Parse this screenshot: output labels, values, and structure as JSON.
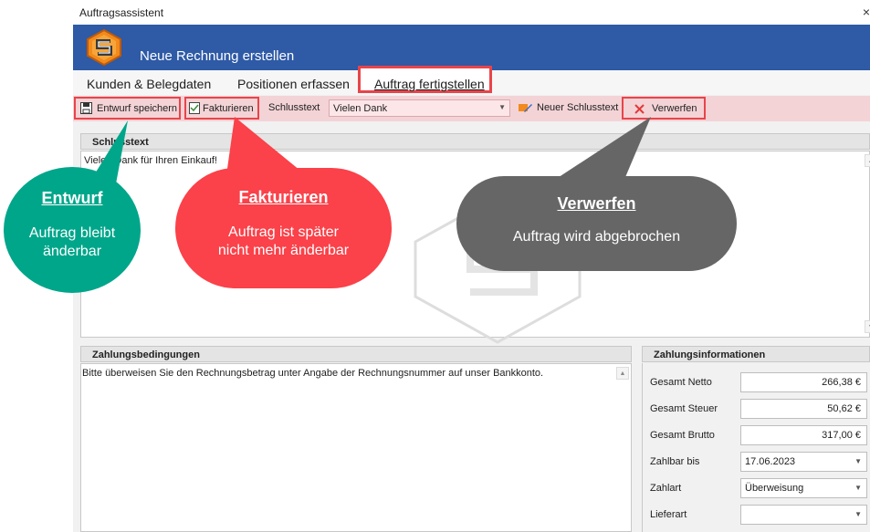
{
  "window": {
    "title": "Auftragsassistent",
    "close_glyph": "×"
  },
  "header": {
    "title": "Neue Rechnung erstellen",
    "color": "#2e5aa6"
  },
  "tabs": [
    {
      "label": "Kunden & Belegdaten"
    },
    {
      "label": "Positionen erfassen"
    },
    {
      "label": "Auftrag fertigstellen",
      "active": true
    }
  ],
  "toolbar": {
    "save_draft": "Entwurf speichern",
    "invoice": "Fakturieren",
    "closing_text_label": "Schlusstext",
    "closing_text_value": "Vielen Dank",
    "new_closing_text": "Neuer Schlusstext",
    "discard": "Verwerfen",
    "highlight_color": "#e8444a"
  },
  "closing_panel": {
    "title": "Schlusstext",
    "text": "Vielen Dank für Ihren Einkauf!"
  },
  "payment_terms": {
    "title": "Zahlungsbedingungen",
    "text": "Bitte überweisen Sie den Rechnungsbetrag unter Angabe der Rechnungsnummer auf unser Bankkonto."
  },
  "payment_info": {
    "title": "Zahlungsinformationen",
    "net_label": "Gesamt Netto",
    "net_value": "266,38 €",
    "tax_label": "Gesamt Steuer",
    "tax_value": "50,62 €",
    "gross_label": "Gesamt Brutto",
    "gross_value": "317,00 €",
    "due_label": "Zahlbar bis",
    "due_value": "17.06.2023",
    "payment_type_label": "Zahlart",
    "payment_type_value": "Überweisung",
    "delivery_label": "Lieferart",
    "delivery_value": ""
  },
  "callouts": {
    "draft": {
      "title": "Entwurf",
      "text1": "Auftrag bleibt",
      "text2": "änderbar",
      "color": "#00a68a"
    },
    "invoice": {
      "title": "Fakturieren",
      "text1": "Auftrag ist später",
      "text2": "nicht mehr änderbar",
      "color": "#fb4149"
    },
    "discard": {
      "title": "Verwerfen",
      "text1": "Auftrag wird abgebrochen",
      "color": "#666666"
    }
  }
}
